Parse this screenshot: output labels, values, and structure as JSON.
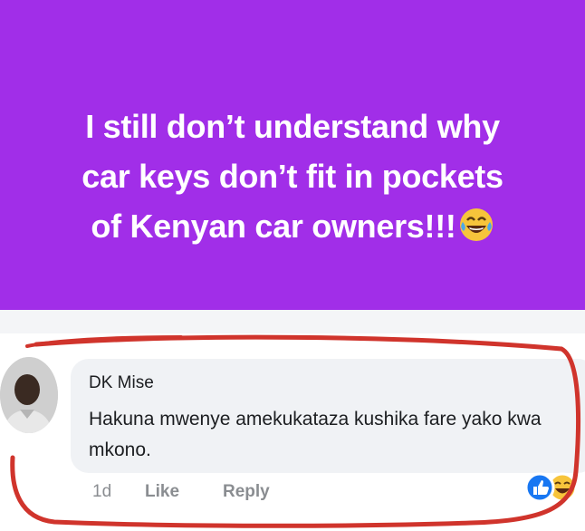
{
  "post": {
    "lines": [
      "I still don’t understand why",
      "car keys don’t fit in pockets",
      "of Kenyan car owners!!!"
    ],
    "emoji": "laughing-tears-emoji",
    "background_color": "#a12ee8"
  },
  "comment": {
    "author": "DK Mise",
    "body": "Hakuna mwenye amekukataza kushika fare yako kwa mkono.",
    "time": "1d",
    "like_label": "Like",
    "reply_label": "Reply",
    "reactions": [
      "like-reaction-icon",
      "haha-reaction-icon"
    ]
  },
  "annotation": {
    "outline_color": "#d0342c"
  }
}
